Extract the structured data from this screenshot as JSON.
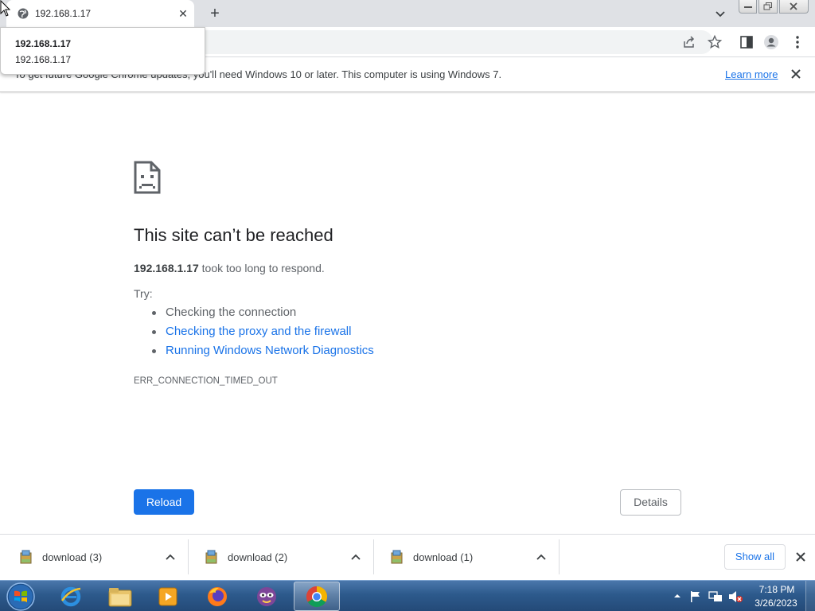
{
  "browser": {
    "tab": {
      "title": "192.168.1.17"
    },
    "omnibox_dropdown": {
      "title": "192.168.1.17",
      "url": "192.168.1.17"
    },
    "infobar": {
      "message": "To get future Google Chrome updates, you'll need Windows 10 or later. This computer is using Windows 7.",
      "link": "Learn more"
    }
  },
  "error_page": {
    "title": "This site can’t be reached",
    "host": "192.168.1.17",
    "description_suffix": " took too long to respond.",
    "try_label": "Try:",
    "suggestions": [
      "Checking the connection",
      "Checking the proxy and the firewall",
      "Running Windows Network Diagnostics"
    ],
    "error_code": "ERR_CONNECTION_TIMED_OUT",
    "reload_label": "Reload",
    "details_label": "Details"
  },
  "downloads": {
    "items": [
      {
        "name": "download (3)"
      },
      {
        "name": "download (2)"
      },
      {
        "name": "download (1)"
      }
    ],
    "show_all_label": "Show all"
  },
  "taskbar": {
    "apps": [
      "internet-explorer-icon",
      "file-explorer-icon",
      "media-player-icon",
      "firefox-icon",
      "tor-browser-icon",
      "chrome-icon"
    ],
    "clock": {
      "time": "7:18 PM",
      "date": "3/26/2023"
    }
  },
  "colors": {
    "link": "#1a73e8",
    "reload_button": "#1a73e8",
    "taskbar": "#2d5a8c"
  }
}
